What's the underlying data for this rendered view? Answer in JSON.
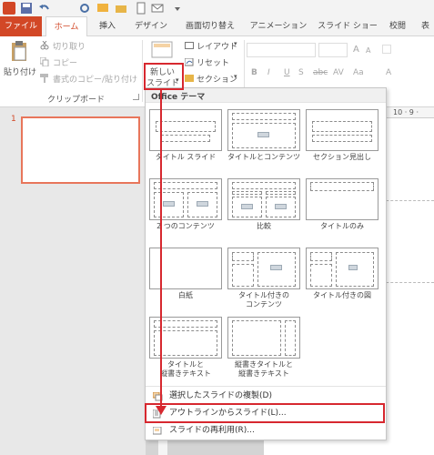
{
  "tabs": {
    "file": "ファイル",
    "home": "ホーム",
    "insert": "挿入",
    "design": "デザイン",
    "transitions": "画面切り替え",
    "animations": "アニメーション",
    "slideshow": "スライド ショー",
    "review": "校閲",
    "view": "表"
  },
  "ribbon": {
    "paste": "貼り付け",
    "cut": "切り取り",
    "copy": "コピー",
    "format_painter": "書式のコピー/貼り付け",
    "clipboard_group": "クリップボード",
    "new_slide_line1": "新しい",
    "new_slide_line2": "スライド",
    "layout": "レイアウト",
    "reset": "リセット",
    "section": "セクション",
    "font_buttons": [
      "B",
      "I",
      "U",
      "S",
      "abc",
      "AV",
      "Aa",
      "A"
    ],
    "font_size_up": "A",
    "font_size_down": "A"
  },
  "slide_panel": {
    "slide_number": "1"
  },
  "ruler": {
    "marks": "10 · 9 ·"
  },
  "gallery": {
    "header": "Office テーマ",
    "layouts": [
      {
        "name": "タイトル スライド"
      },
      {
        "name": "タイトルとコンテンツ"
      },
      {
        "name": "セクション見出し"
      },
      {
        "name": "2 つのコンテンツ"
      },
      {
        "name": "比較"
      },
      {
        "name": "タイトルのみ"
      },
      {
        "name": "白紙"
      },
      {
        "name": "タイトル付きの\nコンテンツ"
      },
      {
        "name": "タイトル付きの図"
      },
      {
        "name": "タイトルと\n縦書きテキスト"
      },
      {
        "name": "縦書きタイトルと\n縦書きテキスト"
      }
    ],
    "menu": {
      "duplicate": "選択したスライドの複製(D)",
      "outline": "アウトラインからスライド(L)...",
      "reuse": "スライドの再利用(R)..."
    }
  },
  "colors": {
    "accent": "#d24726",
    "annotation": "#d7282f"
  }
}
